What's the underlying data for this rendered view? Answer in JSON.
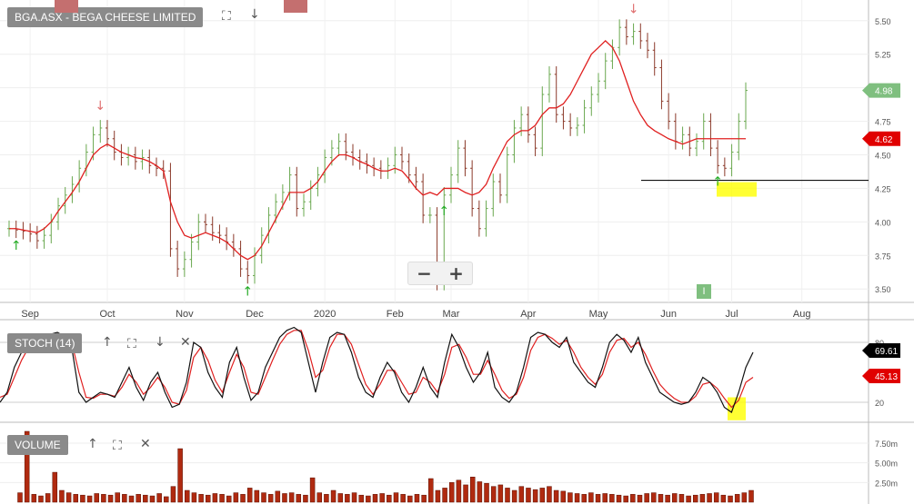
{
  "header": {
    "title": "BGA.ASX - BEGA CHEESE LIMITED",
    "stoch_label": "STOCH (14)",
    "volume_label": "VOLUME"
  },
  "chart_data": [
    {
      "type": "candlestick",
      "x_labels": [
        "Sep",
        "Oct",
        "Nov",
        "Dec",
        "2020",
        "Feb",
        "Mar",
        "Apr",
        "May",
        "Jun",
        "Jul",
        "Aug"
      ],
      "y_ticks": [
        3.5,
        3.75,
        4.0,
        4.25,
        4.5,
        4.75,
        5.0,
        5.25,
        5.5
      ],
      "ylim": [
        3.4,
        5.6
      ],
      "current_price_label": "4.98",
      "ma_label": "4.62",
      "support_line": 4.31,
      "close": [
        3.95,
        3.94,
        3.93,
        3.91,
        3.86,
        3.9,
        4.0,
        4.12,
        4.2,
        4.28,
        4.4,
        4.52,
        4.65,
        4.7,
        4.62,
        4.52,
        4.48,
        4.5,
        4.45,
        4.48,
        4.42,
        4.4,
        4.38,
        3.8,
        3.65,
        3.72,
        3.85,
        4.0,
        3.98,
        3.92,
        3.9,
        3.85,
        3.8,
        3.65,
        3.6,
        3.75,
        3.9,
        4.05,
        4.15,
        4.22,
        4.35,
        4.1,
        4.15,
        4.25,
        4.35,
        4.48,
        4.55,
        4.6,
        4.52,
        4.48,
        4.45,
        4.42,
        4.4,
        4.38,
        4.42,
        4.5,
        4.45,
        4.35,
        4.3,
        4.05,
        4.05,
        3.55,
        4.2,
        4.35,
        4.55,
        4.4,
        4.1,
        3.95,
        4.1,
        4.3,
        4.2,
        4.5,
        4.7,
        4.8,
        4.65,
        4.55,
        4.95,
        5.1,
        4.8,
        4.75,
        4.7,
        4.72,
        4.85,
        4.95,
        5.05,
        5.2,
        5.3,
        5.45,
        5.38,
        5.42,
        5.35,
        5.28,
        5.15,
        4.9,
        4.75,
        4.6,
        4.65,
        4.55,
        4.6,
        4.75,
        4.55,
        4.42,
        4.4,
        4.52,
        4.75,
        4.98
      ],
      "ma": [
        3.95,
        3.95,
        3.94,
        3.93,
        3.92,
        3.95,
        4.0,
        4.08,
        4.15,
        4.22,
        4.3,
        4.4,
        4.5,
        4.55,
        4.58,
        4.55,
        4.52,
        4.5,
        4.48,
        4.47,
        4.45,
        4.42,
        4.38,
        4.15,
        4.0,
        3.9,
        3.88,
        3.9,
        3.92,
        3.9,
        3.88,
        3.85,
        3.8,
        3.75,
        3.72,
        3.75,
        3.82,
        3.92,
        4.02,
        4.12,
        4.22,
        4.22,
        4.22,
        4.25,
        4.3,
        4.38,
        4.45,
        4.5,
        4.5,
        4.48,
        4.45,
        4.43,
        4.4,
        4.38,
        4.38,
        4.4,
        4.38,
        4.32,
        4.25,
        4.2,
        4.22,
        4.2,
        4.25,
        4.25,
        4.25,
        4.22,
        4.2,
        4.22,
        4.28,
        4.4,
        4.5,
        4.6,
        4.65,
        4.68,
        4.68,
        4.72,
        4.8,
        4.85,
        4.85,
        4.88,
        4.95,
        5.05,
        5.15,
        5.25,
        5.3,
        5.35,
        5.3,
        5.2,
        5.05,
        4.9,
        4.8,
        4.72,
        4.68,
        4.65,
        4.62,
        4.6,
        4.58,
        4.6,
        4.62,
        4.62,
        4.62,
        4.62,
        4.62,
        4.62,
        4.62,
        4.62
      ],
      "arrows": [
        {
          "index": 1,
          "dir": "up"
        },
        {
          "index": 13,
          "dir": "down"
        },
        {
          "index": 34,
          "dir": "up"
        },
        {
          "index": 62,
          "dir": "up"
        },
        {
          "index": 89,
          "dir": "down"
        },
        {
          "index": 101,
          "dir": "up"
        }
      ]
    },
    {
      "type": "line",
      "name": "STOCH (14)",
      "y_ticks": [
        20,
        80
      ],
      "ylim": [
        0,
        100
      ],
      "k_label": "69.61",
      "d_label": "45.13",
      "k": [
        20,
        30,
        55,
        70,
        80,
        78,
        82,
        88,
        90,
        86,
        75,
        30,
        20,
        25,
        30,
        28,
        25,
        40,
        55,
        35,
        22,
        40,
        50,
        30,
        15,
        18,
        40,
        80,
        75,
        50,
        35,
        25,
        60,
        75,
        45,
        22,
        30,
        55,
        70,
        85,
        92,
        95,
        90,
        60,
        30,
        60,
        85,
        90,
        88,
        70,
        45,
        30,
        25,
        45,
        60,
        50,
        30,
        20,
        35,
        55,
        35,
        25,
        60,
        88,
        75,
        55,
        40,
        50,
        70,
        35,
        25,
        20,
        30,
        55,
        85,
        90,
        88,
        80,
        75,
        85,
        60,
        50,
        40,
        35,
        55,
        80,
        88,
        82,
        70,
        85,
        60,
        45,
        30,
        25,
        20,
        18,
        20,
        30,
        45,
        40,
        30,
        15,
        10,
        30,
        55,
        70
      ],
      "d": [
        25,
        28,
        45,
        62,
        75,
        78,
        80,
        85,
        88,
        88,
        80,
        50,
        25,
        24,
        28,
        28,
        26,
        35,
        48,
        40,
        28,
        35,
        45,
        35,
        20,
        18,
        32,
        65,
        75,
        62,
        42,
        30,
        50,
        68,
        55,
        30,
        28,
        45,
        62,
        78,
        88,
        92,
        92,
        72,
        45,
        52,
        75,
        88,
        88,
        78,
        58,
        38,
        28,
        38,
        52,
        52,
        40,
        28,
        30,
        45,
        40,
        30,
        48,
        75,
        78,
        65,
        48,
        48,
        62,
        48,
        32,
        24,
        28,
        45,
        72,
        85,
        88,
        84,
        78,
        82,
        70,
        55,
        45,
        38,
        48,
        70,
        82,
        84,
        75,
        80,
        68,
        52,
        38,
        30,
        24,
        20,
        20,
        26,
        38,
        40,
        34,
        24,
        15,
        22,
        40,
        45
      ]
    },
    {
      "type": "bar",
      "name": "VOLUME",
      "y_ticks": [
        2.5,
        5.0,
        7.5
      ],
      "y_tick_labels": [
        "2.50m",
        "5.00m",
        "7.50m"
      ],
      "ylim": [
        0,
        9
      ],
      "values": [
        1.2,
        9.0,
        1.0,
        0.8,
        1.1,
        3.8,
        1.5,
        1.2,
        1.0,
        0.9,
        0.8,
        1.1,
        1.0,
        0.9,
        1.2,
        1.0,
        0.8,
        1.0,
        0.9,
        0.8,
        1.1,
        0.7,
        2.0,
        6.8,
        1.5,
        1.2,
        1.0,
        0.9,
        1.1,
        1.0,
        0.8,
        1.2,
        1.0,
        1.8,
        1.5,
        1.2,
        1.0,
        1.4,
        1.1,
        1.2,
        1.0,
        0.9,
        3.1,
        1.2,
        1.0,
        1.5,
        1.1,
        1.0,
        1.2,
        0.9,
        0.8,
        1.0,
        1.1,
        0.9,
        1.2,
        1.0,
        0.8,
        1.0,
        0.9,
        3.0,
        1.5,
        1.8,
        2.5,
        2.8,
        2.2,
        3.2,
        2.6,
        2.4,
        2.0,
        2.2,
        1.8,
        1.5,
        2.0,
        1.8,
        1.6,
        1.8,
        2.0,
        1.5,
        1.4,
        1.2,
        1.1,
        1.0,
        1.2,
        1.0,
        1.1,
        1.0,
        0.9,
        0.8,
        1.0,
        0.9,
        1.1,
        1.2,
        1.0,
        0.9,
        1.1,
        1.0,
        0.8,
        0.9,
        1.0,
        1.1,
        1.2,
        0.9,
        0.8,
        1.0,
        1.2,
        1.5
      ]
    }
  ]
}
